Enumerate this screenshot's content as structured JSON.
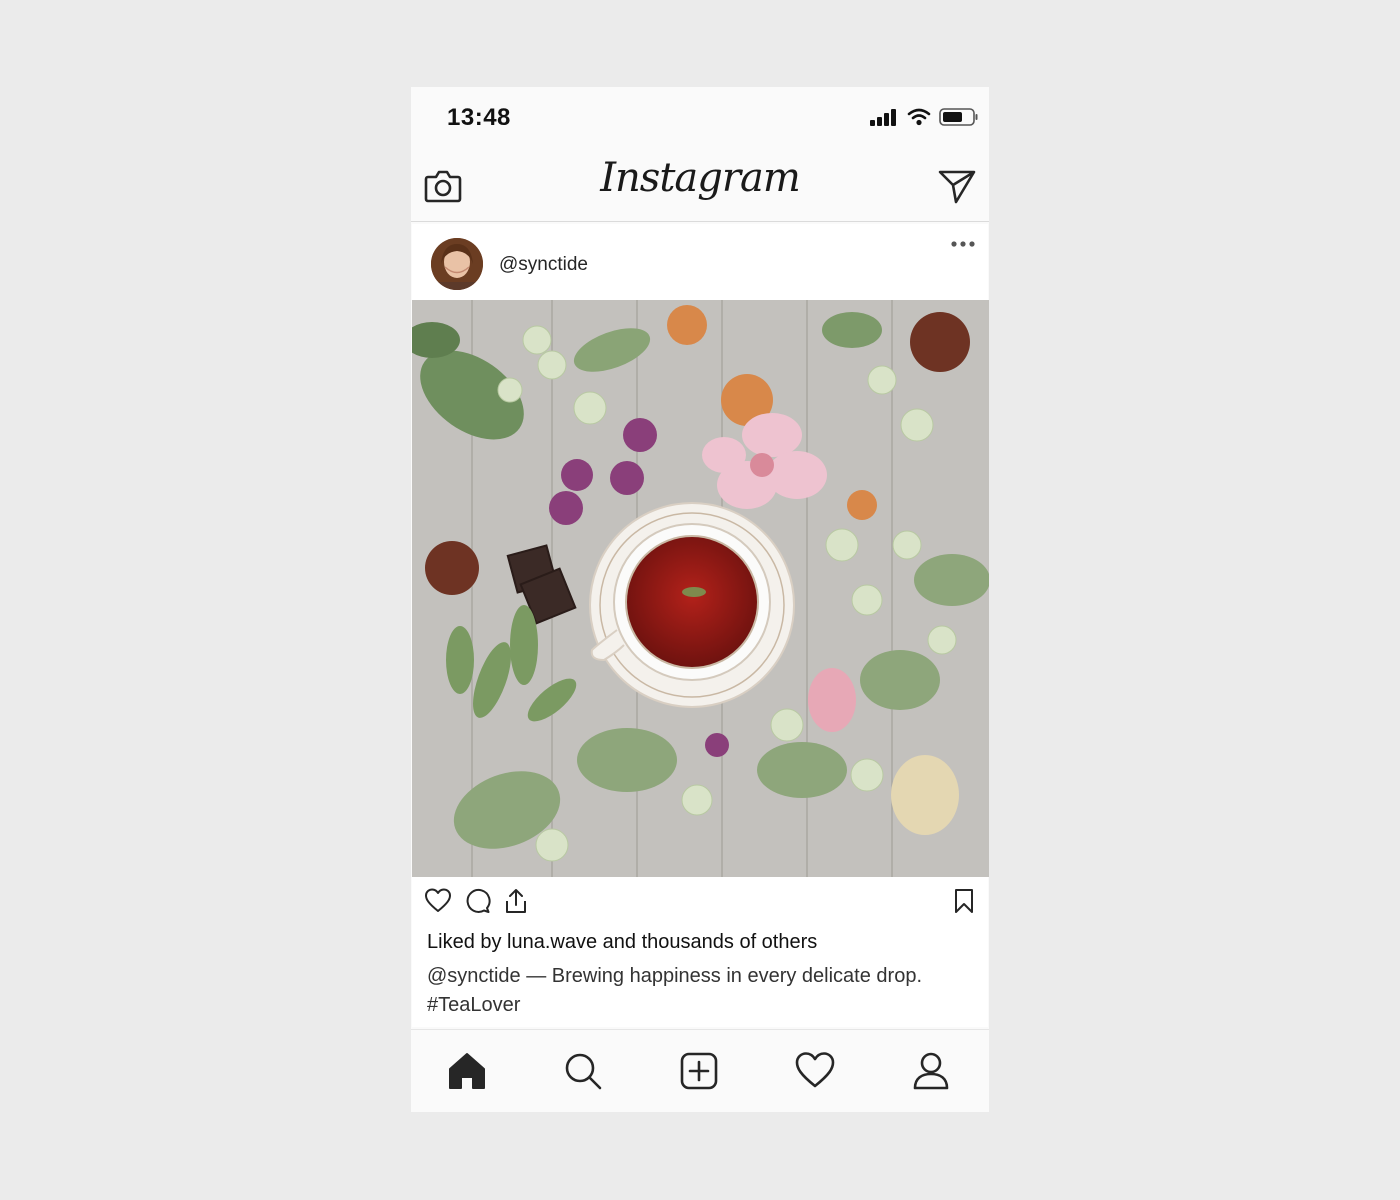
{
  "status_bar": {
    "time": "13:48",
    "icons": [
      "signal-icon",
      "wifi-icon",
      "battery-icon"
    ]
  },
  "top_nav": {
    "logo": "Instagram",
    "left_icon": "camera-icon",
    "right_icon": "send-icon"
  },
  "post": {
    "username": "@synctide",
    "image_subject": "tea-cup-flatlay-photo",
    "actions": [
      "like-icon",
      "comment-icon",
      "share-icon",
      "bookmark-icon"
    ],
    "likes_text": "Liked by luna.wave and thousands of others",
    "caption_user": "@synctide",
    "caption_text": " — Brewing happiness in every delicate drop. #TeaLover"
  },
  "bottom_nav": {
    "tabs": [
      "home-icon",
      "search-icon",
      "add-post-icon",
      "activity-heart-icon",
      "profile-icon"
    ]
  },
  "colors": {
    "page_bg": "#ebebeb",
    "app_bg": "#fafafa",
    "text": "#262626",
    "divider": "#dbdbdb"
  }
}
